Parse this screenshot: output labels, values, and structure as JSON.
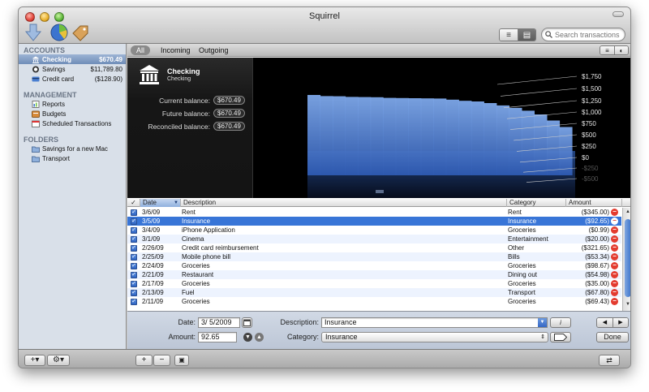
{
  "window": {
    "title": "Squirrel"
  },
  "toolbar": {
    "search_placeholder": "Search transactions",
    "view_toggle": [
      "list",
      "detail"
    ]
  },
  "sidebar": {
    "accounts_header": "ACCOUNTS",
    "accounts": [
      {
        "label": "Checking",
        "value": "$670.49",
        "icon": "bank-icon",
        "selected": true
      },
      {
        "label": "Savings",
        "value": "$11,789.80",
        "icon": "savings-icon"
      },
      {
        "label": "Credit card",
        "value": "($128.90)",
        "icon": "credit-card-icon"
      }
    ],
    "management_header": "MANAGEMENT",
    "management": [
      {
        "label": "Reports",
        "icon": "reports-icon"
      },
      {
        "label": "Budgets",
        "icon": "budgets-icon"
      },
      {
        "label": "Scheduled Transactions",
        "icon": "calendar-icon"
      }
    ],
    "folders_header": "FOLDERS",
    "folders": [
      {
        "label": "Savings for a new Mac",
        "icon": "folder-icon"
      },
      {
        "label": "Transport",
        "icon": "folder-icon"
      }
    ]
  },
  "filters": {
    "all": "All",
    "incoming": "Incoming",
    "outgoing": "Outgoing"
  },
  "account_panel": {
    "name": "Checking",
    "subtitle": "Checking",
    "current_label": "Current balance:",
    "current_value": "$670.49",
    "future_label": "Future balance:",
    "future_value": "$670.49",
    "reconciled_label": "Reconciled balance:",
    "reconciled_value": "$670.49"
  },
  "chart_data": {
    "type": "area",
    "y_ticks": [
      "$1,750",
      "$1,500",
      "$1,250",
      "$1,000",
      "$750",
      "$500",
      "$250",
      "$0",
      "-$250",
      "-$500"
    ],
    "ylim": [
      -500,
      1750
    ],
    "values": [
      1500,
      1470,
      1460,
      1440,
      1430,
      1420,
      1400,
      1390,
      1380,
      1370,
      1360,
      1330,
      1300,
      1280,
      1240,
      1180,
      1120,
      1050,
      960,
      820,
      670
    ],
    "color": "#5f8dd6"
  },
  "table": {
    "headers": {
      "check": "✓",
      "date": "Date",
      "description": "Description",
      "category": "Category",
      "amount": "Amount"
    },
    "rows": [
      {
        "date": "3/6/09",
        "description": "Rent",
        "category": "Rent",
        "amount": "($345.00)"
      },
      {
        "date": "3/5/09",
        "description": "Insurance",
        "category": "Insurance",
        "amount": "($92.65)",
        "selected": true
      },
      {
        "date": "3/4/09",
        "description": "iPhone Application",
        "category": "Groceries",
        "amount": "($0.99)"
      },
      {
        "date": "3/1/09",
        "description": "Cinema",
        "category": "Entertainment",
        "amount": "($20.00)"
      },
      {
        "date": "2/26/09",
        "description": "Credit card reimbursement",
        "category": "Other",
        "amount": "($321.65)"
      },
      {
        "date": "2/25/09",
        "description": "Mobile phone bill",
        "category": "Bills",
        "amount": "($53.34)"
      },
      {
        "date": "2/24/09",
        "description": "Groceries",
        "category": "Groceries",
        "amount": "($98.67)"
      },
      {
        "date": "2/21/09",
        "description": "Restaurant",
        "category": "Dining out",
        "amount": "($54.98)"
      },
      {
        "date": "2/17/09",
        "description": "Groceries",
        "category": "Groceries",
        "amount": "($35.00)"
      },
      {
        "date": "2/13/09",
        "description": "Fuel",
        "category": "Transport",
        "amount": "($67.80)"
      },
      {
        "date": "2/11/09",
        "description": "Groceries",
        "category": "Groceries",
        "amount": "($69.43)"
      }
    ]
  },
  "editor": {
    "date_label": "Date:",
    "date_value": "3/ 5/2009",
    "amount_label": "Amount:",
    "amount_value": "92.65",
    "description_label": "Description:",
    "description_value": "Insurance",
    "category_label": "Category:",
    "category_value": "Insurance",
    "done_label": "Done"
  },
  "bottombar": {
    "add_label": "+▾",
    "gear_label": "⚙▾",
    "plus_label": "+",
    "minus_label": "−"
  }
}
